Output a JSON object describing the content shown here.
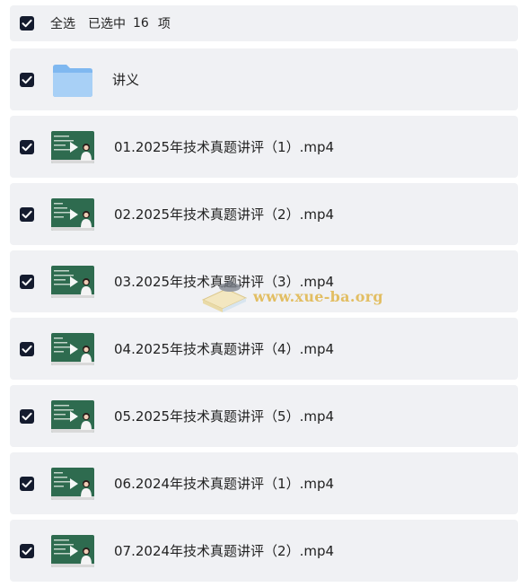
{
  "header": {
    "select_all_label": "全选",
    "selected_prefix": "已选中",
    "selected_count": "16",
    "selected_suffix": "项",
    "checked": true
  },
  "items": [
    {
      "type": "folder",
      "name": "讲义",
      "checked": true,
      "icon": "folder-icon"
    },
    {
      "type": "video",
      "name": "01.2025年技术真题讲评（1）.mp4",
      "checked": true,
      "icon": "video-thumbnail"
    },
    {
      "type": "video",
      "name": "02.2025年技术真题讲评（2）.mp4",
      "checked": true,
      "icon": "video-thumbnail"
    },
    {
      "type": "video",
      "name": "03.2025年技术真题讲评（3）.mp4",
      "checked": true,
      "icon": "video-thumbnail"
    },
    {
      "type": "video",
      "name": "04.2025年技术真题讲评（4）.mp4",
      "checked": true,
      "icon": "video-thumbnail"
    },
    {
      "type": "video",
      "name": "05.2025年技术真题讲评（5）.mp4",
      "checked": true,
      "icon": "video-thumbnail"
    },
    {
      "type": "video",
      "name": "06.2024年技术真题讲评（1）.mp4",
      "checked": true,
      "icon": "video-thumbnail"
    },
    {
      "type": "video",
      "name": "07.2024年技术真题讲评（2）.mp4",
      "checked": true,
      "icon": "video-thumbnail"
    }
  ],
  "watermark": {
    "text": "www.xue-ba.org"
  },
  "colors": {
    "row_bg": "#f0f1f4",
    "checkbox": "#141b2e",
    "thumb_board": "#2e6b4f",
    "folder": "#7fb8f0",
    "watermark": "#e0b64a"
  }
}
